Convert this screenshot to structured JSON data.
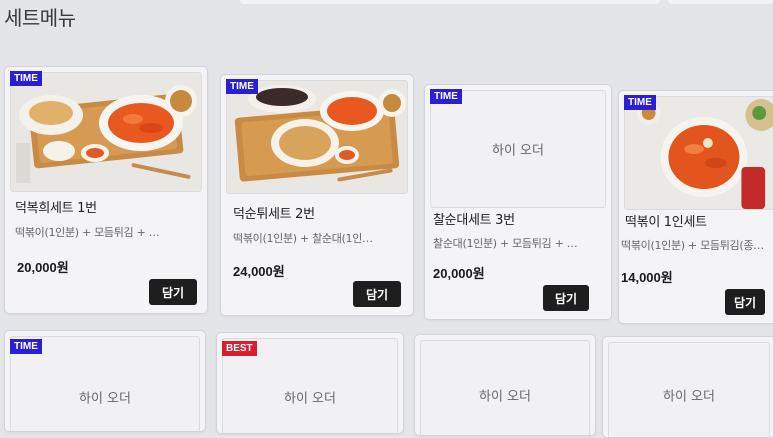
{
  "section": {
    "title": "세트메뉴"
  },
  "placeholder_text": "하이 오더",
  "add_label": "담기",
  "colors": {
    "time_badge": "#2b1fd6",
    "best_badge": "#d62030",
    "add_button": "#1e1e1e"
  },
  "menu": [
    {
      "badge": "TIME",
      "image": "food-photo",
      "name": "덕복희세트 1번",
      "desc": "떡볶이(1인분) + 모듬튀김 + …",
      "price": "20,000원"
    },
    {
      "badge": "TIME",
      "image": "food-photo",
      "name": "덕순튀세트 2번",
      "desc": "떡볶이(1인분) + 찰순대(1인…",
      "price": "24,000원"
    },
    {
      "badge": "TIME",
      "image": "placeholder",
      "name": "찰순대세트 3번",
      "desc": "찰순대(1인분) + 모듬튀김 + …",
      "price": "20,000원"
    },
    {
      "badge": "TIME",
      "image": "food-photo",
      "name": "떡볶이 1인세트",
      "desc": "떡볶이(1인분) + 모듬튀김(종…",
      "price": "14,000원"
    }
  ],
  "menu_row2": [
    {
      "badge": "TIME",
      "image": "placeholder"
    },
    {
      "badge": "BEST",
      "image": "placeholder"
    },
    {
      "badge": "",
      "image": "placeholder"
    },
    {
      "badge": "",
      "image": "placeholder"
    }
  ]
}
